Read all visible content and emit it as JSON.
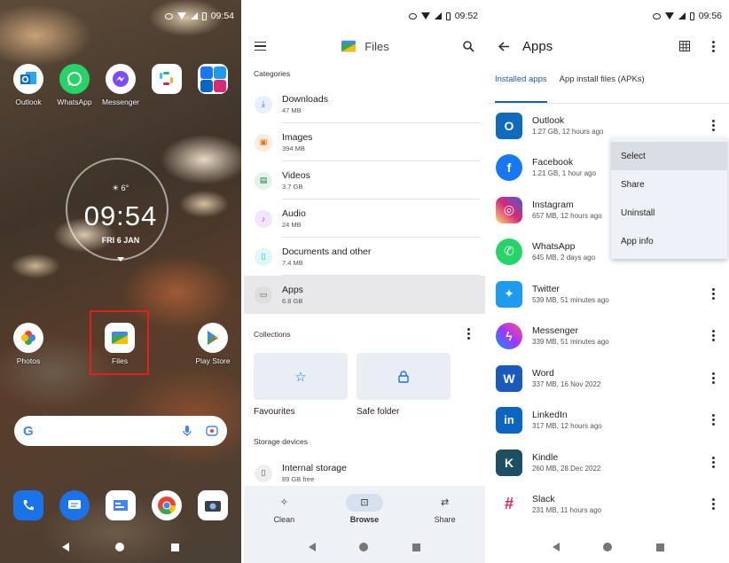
{
  "home": {
    "status_time": "09:54",
    "apps_top": [
      {
        "label": "Outlook",
        "name": "outlook"
      },
      {
        "label": "WhatsApp",
        "name": "whatsapp"
      },
      {
        "label": "Messenger",
        "name": "messenger"
      },
      {
        "label": "",
        "name": "slack-folder"
      },
      {
        "label": "",
        "name": "social-folder"
      }
    ],
    "clock": {
      "time": "09:54",
      "date": "FRI 6 JAN",
      "weather": "6°"
    },
    "apps_mid": [
      {
        "label": "Photos",
        "name": "photos"
      },
      {
        "label": "Files",
        "name": "files"
      },
      {
        "label": "Play Store",
        "name": "play-store"
      }
    ]
  },
  "files": {
    "status_time": "09:52",
    "title": "Files",
    "categories_header": "Categories",
    "categories": [
      {
        "name": "Downloads",
        "sub": "47 MB",
        "icon": "download-icon",
        "color": "#1a73e8"
      },
      {
        "name": "Images",
        "sub": "394 MB",
        "icon": "image-icon",
        "color": "#e8710a"
      },
      {
        "name": "Videos",
        "sub": "3.7 GB",
        "icon": "video-icon",
        "color": "#188038"
      },
      {
        "name": "Audio",
        "sub": "24 MB",
        "icon": "audio-icon",
        "color": "#9334e6"
      },
      {
        "name": "Documents and other",
        "sub": "7.4 MB",
        "icon": "document-icon",
        "color": "#12b5cb"
      },
      {
        "name": "Apps",
        "sub": "6.8 GB",
        "icon": "apps-icon",
        "color": "#555555"
      }
    ],
    "collections_header": "Collections",
    "collections": [
      {
        "label": "Favourites",
        "icon": "star-icon"
      },
      {
        "label": "Safe folder",
        "icon": "lock-icon"
      }
    ],
    "storage_header": "Storage devices",
    "storage": {
      "name": "Internal storage",
      "sub": "89 GB free"
    },
    "tabs": [
      {
        "label": "Clean",
        "icon": "sparkle-icon"
      },
      {
        "label": "Browse",
        "icon": "browse-icon"
      },
      {
        "label": "Share",
        "icon": "share-arrows-icon"
      }
    ]
  },
  "apps": {
    "status_time": "09:56",
    "title": "Apps",
    "tabs": [
      "Installed apps",
      "App install files (APKs)"
    ],
    "list": [
      {
        "name": "Outlook",
        "sub": "1.27 GB, 12 hours ago",
        "color": "#0f6cbd",
        "glyph": "O"
      },
      {
        "name": "Facebook",
        "sub": "1.21 GB, 1 hour ago",
        "color": "#1877f2",
        "glyph": "f"
      },
      {
        "name": "Instagram",
        "sub": "657 MB, 12 hours ago",
        "color": "#d62976",
        "glyph": "◎"
      },
      {
        "name": "WhatsApp",
        "sub": "645 MB, 2 days ago",
        "color": "#25d366",
        "glyph": "✆"
      },
      {
        "name": "Twitter",
        "sub": "539 MB, 51 minutes ago",
        "color": "#1d9bf0",
        "glyph": "✦"
      },
      {
        "name": "Messenger",
        "sub": "339 MB, 51 minutes ago",
        "color": "#a334fa",
        "glyph": "ϟ"
      },
      {
        "name": "Word",
        "sub": "337 MB, 16 Nov 2022",
        "color": "#185abd",
        "glyph": "W"
      },
      {
        "name": "LinkedIn",
        "sub": "317 MB, 12 hours ago",
        "color": "#0a66c2",
        "glyph": "in"
      },
      {
        "name": "Kindle",
        "sub": "260 MB, 28 Dec 2022",
        "color": "#1c4f63",
        "glyph": "K"
      },
      {
        "name": "Slack",
        "sub": "231 MB, 11 hours ago",
        "color": "#ffffff",
        "glyph": "#"
      }
    ],
    "menu": [
      "Select",
      "Share",
      "Uninstall",
      "App info"
    ]
  }
}
